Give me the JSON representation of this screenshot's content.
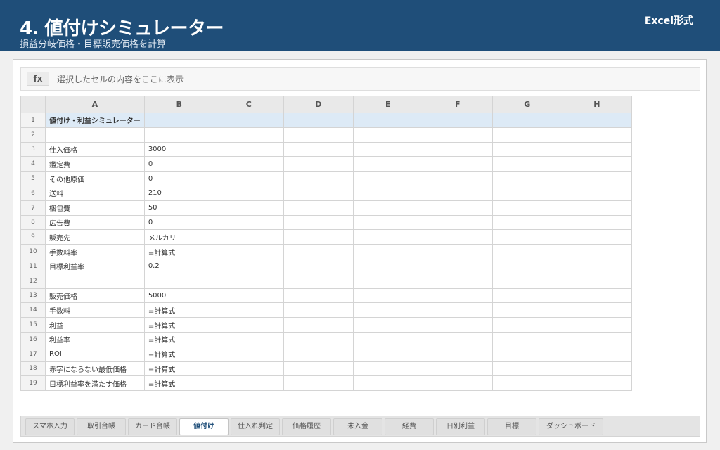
{
  "header": {
    "title": "4. 値付けシミュレーター",
    "subtitle": "損益分岐価格・目標販売価格を計算",
    "badge": "Excel形式"
  },
  "formula_bar": {
    "fx_label": "fx",
    "text": "選択したセルの内容をここに表示"
  },
  "sheet": {
    "columns": [
      "A",
      "B",
      "C",
      "D",
      "E",
      "F",
      "G",
      "H"
    ],
    "rows": [
      {
        "num": "1",
        "a": "値付け・利益シミュレーター",
        "b": ""
      },
      {
        "num": "2",
        "a": "",
        "b": ""
      },
      {
        "num": "3",
        "a": "仕入価格",
        "b": "3000"
      },
      {
        "num": "4",
        "a": "鑑定費",
        "b": "0"
      },
      {
        "num": "5",
        "a": "その他原価",
        "b": "0"
      },
      {
        "num": "6",
        "a": "送料",
        "b": "210"
      },
      {
        "num": "7",
        "a": "梱包費",
        "b": "50"
      },
      {
        "num": "8",
        "a": "広告費",
        "b": "0"
      },
      {
        "num": "9",
        "a": "販売先",
        "b": "メルカリ"
      },
      {
        "num": "10",
        "a": "手数料率",
        "b": "=計算式"
      },
      {
        "num": "11",
        "a": "目標利益率",
        "b": "0.2"
      },
      {
        "num": "12",
        "a": "",
        "b": ""
      },
      {
        "num": "13",
        "a": "販売価格",
        "b": "5000"
      },
      {
        "num": "14",
        "a": "手数料",
        "b": "=計算式"
      },
      {
        "num": "15",
        "a": "利益",
        "b": "=計算式"
      },
      {
        "num": "16",
        "a": "利益率",
        "b": "=計算式"
      },
      {
        "num": "17",
        "a": "ROI",
        "b": "=計算式"
      },
      {
        "num": "18",
        "a": "赤字にならない最低価格",
        "b": "=計算式"
      },
      {
        "num": "19",
        "a": "目標利益率を満たす価格",
        "b": "=計算式"
      }
    ]
  },
  "tabs": [
    {
      "label": "スマホ入力",
      "active": false
    },
    {
      "label": "取引台帳",
      "active": false
    },
    {
      "label": "カード台帳",
      "active": false
    },
    {
      "label": "値付け",
      "active": true
    },
    {
      "label": "仕入れ判定",
      "active": false
    },
    {
      "label": "価格履歴",
      "active": false
    },
    {
      "label": "未入金",
      "active": false
    },
    {
      "label": "経費",
      "active": false
    },
    {
      "label": "日別利益",
      "active": false
    },
    {
      "label": "目標",
      "active": false
    },
    {
      "label": "ダッシュボード",
      "active": false
    }
  ],
  "colors": {
    "header_bg": "#1f4e79",
    "title_row_bg": "#ddeaf6",
    "active_tab_text": "#1f4e79"
  }
}
